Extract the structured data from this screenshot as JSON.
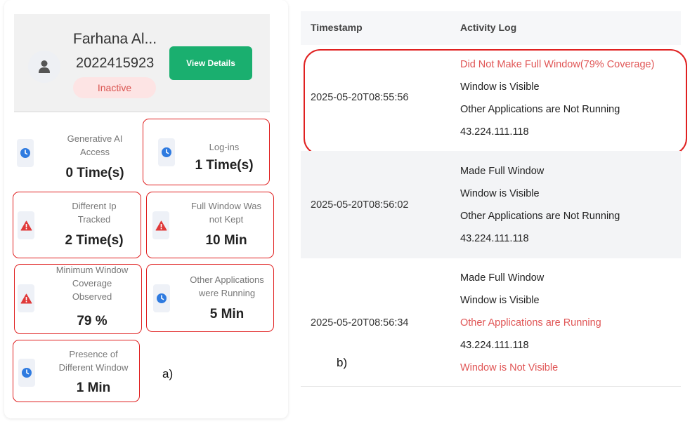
{
  "user": {
    "name": "Farhana Al...",
    "id": "2022415923",
    "status": "Inactive",
    "view_button": "View Details"
  },
  "stats": [
    {
      "label": "Generative AI Access",
      "value": "0 Time(s)",
      "icon": "clock-icon",
      "highlighted": false
    },
    {
      "label": "Log-ins",
      "value": "1 Time(s)",
      "icon": "clock-icon",
      "highlighted": true
    },
    {
      "label": "Different Ip Tracked",
      "value": "2 Time(s)",
      "icon": "warning-icon",
      "highlighted": true
    },
    {
      "label": "Full Window Was not Kept",
      "value": "10 Min",
      "icon": "warning-icon",
      "highlighted": true
    },
    {
      "label": "Minimum Window Coverage Observed",
      "value": "79 %",
      "icon": "warning-icon",
      "highlighted": true
    },
    {
      "label": "Other Applications were Running",
      "value": "5 Min",
      "icon": "clock-icon",
      "highlighted": true
    },
    {
      "label": "Presence of Different Window",
      "value": "1 Min",
      "icon": "clock-icon",
      "highlighted": true
    }
  ],
  "stat_labels": {
    "s0": [
      "Generative AI",
      "Access"
    ],
    "s1": [
      "Log-ins"
    ],
    "s2": [
      "Different Ip",
      "Tracked"
    ],
    "s3": [
      "Full Window Was",
      "not Kept"
    ],
    "s4": [
      "Minimum Window",
      "Coverage",
      "Observed"
    ],
    "s5": [
      "Other Applications",
      "were Running"
    ],
    "s6": [
      "Presence of",
      "Different Window"
    ]
  },
  "panel_labels": {
    "a": "a)",
    "b": "b)"
  },
  "log": {
    "headers": [
      "Timestamp",
      "Activity Log"
    ],
    "rows": [
      {
        "timestamp": "2025-05-20T08:55:56",
        "entries": [
          {
            "text": "Did Not Make Full Window(79% Coverage)",
            "alert": true
          },
          {
            "text": "Window is Visible",
            "alert": false
          },
          {
            "text": "Other Applications are Not Running",
            "alert": false
          },
          {
            "text": "43.224.111.118",
            "alert": false
          }
        ]
      },
      {
        "timestamp": "2025-05-20T08:56:02",
        "entries": [
          {
            "text": "Made Full Window",
            "alert": false
          },
          {
            "text": "Window is Visible",
            "alert": false
          },
          {
            "text": "Other Applications are Not Running",
            "alert": false
          },
          {
            "text": "43.224.111.118",
            "alert": false
          }
        ]
      },
      {
        "timestamp": "2025-05-20T08:56:34",
        "entries": [
          {
            "text": "Made Full Window",
            "alert": false
          },
          {
            "text": "Window is Visible",
            "alert": false
          },
          {
            "text": "Other Applications are Running",
            "alert": true
          },
          {
            "text": "43.224.111.118",
            "alert": false
          },
          {
            "text": "Window is Not Visible",
            "alert": true
          }
        ]
      }
    ]
  },
  "colors": {
    "accent_green": "#1aaf6f",
    "alert_red": "#e05555",
    "highlight_red": "#e02020",
    "clock_blue": "#2f7be0",
    "warning_red": "#e03a3a"
  }
}
